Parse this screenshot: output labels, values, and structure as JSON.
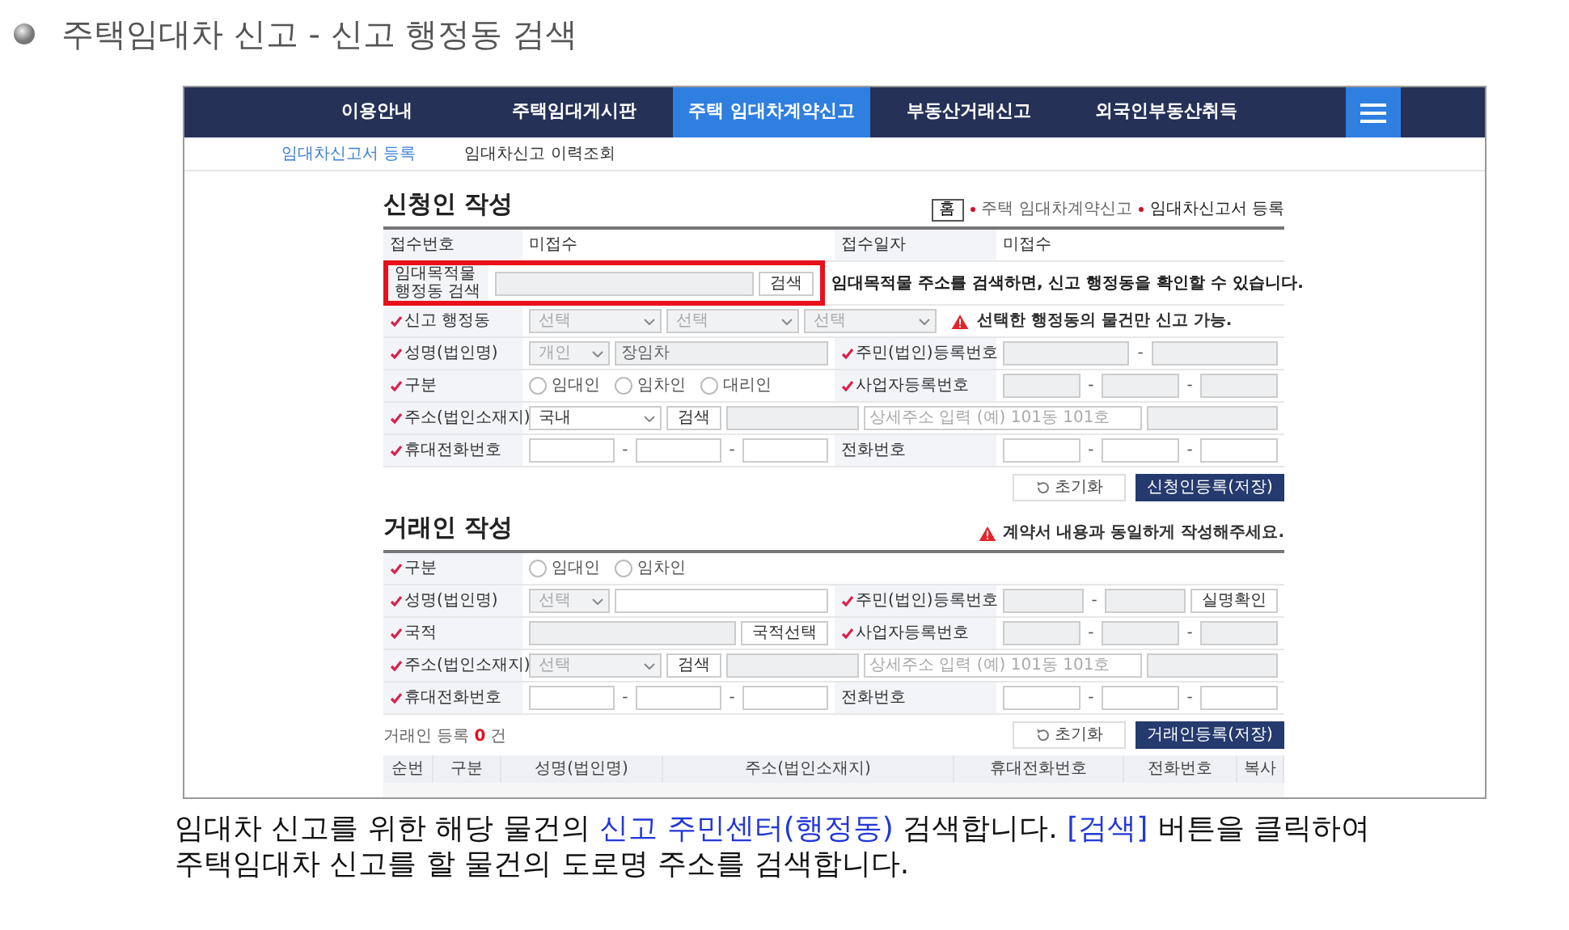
{
  "slide": {
    "title": "주택임대차 신고 - 신고 행정동 검색"
  },
  "nav": {
    "items": [
      {
        "label": "이용안내",
        "selected": false
      },
      {
        "label": "주택임대게시판",
        "selected": false
      },
      {
        "label": "주택 임대차계약신고",
        "selected": true
      },
      {
        "label": "부동산거래신고",
        "selected": false
      },
      {
        "label": "외국인부동산취득",
        "selected": false
      }
    ]
  },
  "subnav": {
    "items": [
      {
        "label": "임대차신고서 등록",
        "selected": true
      },
      {
        "label": "임대차신고 이력조회",
        "selected": false
      }
    ]
  },
  "applicant": {
    "title": "신청인 작성",
    "breadcrumb": {
      "home": "홈",
      "items": [
        {
          "label": "주택 임대차계약신고",
          "selected": false
        },
        {
          "label": "임대차신고서 등록",
          "selected": true
        }
      ]
    },
    "rows": [
      {
        "cells": [
          {
            "label": "접수번호",
            "required": false,
            "controls": [
              {
                "kind": "text",
                "text": "미접수"
              }
            ]
          },
          {
            "label": "접수일자",
            "required": false,
            "controls": [
              {
                "kind": "text",
                "text": "미접수"
              }
            ]
          }
        ]
      },
      {
        "cells": [
          {
            "label": "임대목적물 행정동 검색",
            "required": false,
            "highlighted": true,
            "controls": [
              {
                "kind": "input",
                "disabled": true
              },
              {
                "kind": "button",
                "label": "검색"
              }
            ],
            "note": "임대목적물 주소를 검색하면, 신고 행정동을 확인할 수 있습니다."
          }
        ]
      },
      {
        "cells": [
          {
            "label": "신고 행정동",
            "required": true,
            "controls": [
              {
                "kind": "select",
                "value": "선택",
                "disabled": true
              },
              {
                "kind": "select",
                "value": "선택",
                "disabled": true
              },
              {
                "kind": "select",
                "value": "선택",
                "disabled": true
              },
              {
                "kind": "warning",
                "text": "선택한 행정동의 물건만 신고 가능."
              }
            ]
          }
        ]
      },
      {
        "cells": [
          {
            "label": "성명(법인명)",
            "required": true,
            "controls": [
              {
                "kind": "select",
                "value": "개인",
                "disabled": true
              },
              {
                "kind": "input",
                "value": "장임차",
                "disabled": true
              }
            ]
          },
          {
            "label": "주민(법인)등록번호",
            "required": true,
            "controls": [
              {
                "kind": "input",
                "disabled": true
              },
              {
                "kind": "dash",
                "text": "-"
              },
              {
                "kind": "input",
                "disabled": true
              }
            ]
          }
        ]
      },
      {
        "cells": [
          {
            "label": "구분",
            "required": true,
            "controls": [
              {
                "kind": "radio",
                "label": "임대인",
                "selected": false
              },
              {
                "kind": "radio",
                "label": "임차인",
                "selected": false
              },
              {
                "kind": "radio",
                "label": "대리인",
                "selected": false
              }
            ]
          },
          {
            "label": "사업자등록번호",
            "required": true,
            "controls": [
              {
                "kind": "input",
                "disabled": true
              },
              {
                "kind": "dash",
                "text": "-"
              },
              {
                "kind": "input",
                "disabled": true
              },
              {
                "kind": "dash",
                "text": "-"
              },
              {
                "kind": "input",
                "disabled": true
              }
            ]
          }
        ]
      },
      {
        "cells": [
          {
            "label": "주소(법인소재지)",
            "required": true,
            "controls": [
              {
                "kind": "select",
                "value": "국내",
                "disabled": false
              },
              {
                "kind": "button",
                "label": "검색"
              },
              {
                "kind": "input",
                "disabled": true
              },
              {
                "kind": "input",
                "placeholder": "상세주소 입력 (예) 101동 101호",
                "disabled": false
              },
              {
                "kind": "input",
                "disabled": true
              }
            ]
          }
        ]
      },
      {
        "cells": [
          {
            "label": "휴대전화번호",
            "required": true,
            "controls": [
              {
                "kind": "input",
                "disabled": false
              },
              {
                "kind": "dash",
                "text": "-"
              },
              {
                "kind": "input",
                "disabled": false
              },
              {
                "kind": "dash",
                "text": "-"
              },
              {
                "kind": "input",
                "disabled": false
              }
            ]
          },
          {
            "label": "전화번호",
            "required": false,
            "controls": [
              {
                "kind": "input",
                "disabled": false
              },
              {
                "kind": "dash",
                "text": "-"
              },
              {
                "kind": "input",
                "disabled": false
              },
              {
                "kind": "dash",
                "text": "-"
              },
              {
                "kind": "input",
                "disabled": false
              }
            ]
          }
        ]
      }
    ],
    "buttons": [
      {
        "kind": "reset",
        "label": "초기화"
      },
      {
        "kind": "save",
        "label": "신청인등록(저장)"
      }
    ]
  },
  "counterparty": {
    "title": "거래인 작성",
    "warning": "계약서 내용과 동일하게 작성해주세요.",
    "rows": [
      {
        "cells": [
          {
            "label": "구분",
            "required": true,
            "controls": [
              {
                "kind": "radio",
                "label": "임대인",
                "selected": false
              },
              {
                "kind": "radio",
                "label": "임차인",
                "selected": false
              }
            ]
          }
        ]
      },
      {
        "cells": [
          {
            "label": "성명(법인명)",
            "required": true,
            "controls": [
              {
                "kind": "select",
                "value": "선택",
                "disabled": true
              },
              {
                "kind": "input",
                "disabled": false
              }
            ]
          },
          {
            "label": "주민(법인)등록번호",
            "required": true,
            "controls": [
              {
                "kind": "input",
                "disabled": true
              },
              {
                "kind": "dash",
                "text": "-"
              },
              {
                "kind": "input",
                "disabled": true
              },
              {
                "kind": "button",
                "label": "실명확인"
              }
            ]
          }
        ]
      },
      {
        "cells": [
          {
            "label": "국적",
            "required": true,
            "controls": [
              {
                "kind": "input",
                "disabled": true
              },
              {
                "kind": "button",
                "label": "국적선택"
              }
            ]
          },
          {
            "label": "사업자등록번호",
            "required": true,
            "controls": [
              {
                "kind": "input",
                "disabled": true
              },
              {
                "kind": "dash",
                "text": "-"
              },
              {
                "kind": "input",
                "disabled": true
              },
              {
                "kind": "dash",
                "text": "-"
              },
              {
                "kind": "input",
                "disabled": true
              }
            ]
          }
        ]
      },
      {
        "cells": [
          {
            "label": "주소(법인소재지)",
            "required": true,
            "controls": [
              {
                "kind": "select",
                "value": "선택",
                "disabled": true
              },
              {
                "kind": "button",
                "label": "검색"
              },
              {
                "kind": "input",
                "disabled": true
              },
              {
                "kind": "input",
                "placeholder": "상세주소 입력 (예) 101동 101호",
                "disabled": false
              },
              {
                "kind": "input",
                "disabled": true
              }
            ]
          }
        ]
      },
      {
        "cells": [
          {
            "label": "휴대전화번호",
            "required": true,
            "controls": [
              {
                "kind": "input",
                "disabled": false
              },
              {
                "kind": "dash",
                "text": "-"
              },
              {
                "kind": "input",
                "disabled": false
              },
              {
                "kind": "dash",
                "text": "-"
              },
              {
                "kind": "input",
                "disabled": false
              }
            ]
          },
          {
            "label": "전화번호",
            "required": false,
            "controls": [
              {
                "kind": "input",
                "disabled": false
              },
              {
                "kind": "dash",
                "text": "-"
              },
              {
                "kind": "input",
                "disabled": false
              },
              {
                "kind": "dash",
                "text": "-"
              },
              {
                "kind": "input",
                "disabled": false
              }
            ]
          }
        ]
      }
    ],
    "count": {
      "prefix": "거래인 등록",
      "value": "0",
      "suffix": "건"
    },
    "buttons": [
      {
        "kind": "reset",
        "label": "초기화"
      },
      {
        "kind": "save",
        "label": "거래인등록(저장)"
      }
    ],
    "table": {
      "columns": [
        "순번",
        "구분",
        "성명(법인명)",
        "주소(법인소재지)",
        "휴대전화번호",
        "전화번호",
        "복사"
      ]
    }
  },
  "caption": {
    "segments": [
      {
        "text": "임대차 신고를 위한 해당 물건의 ",
        "emphasis": false
      },
      {
        "text": "신고 주민센터(행정동)",
        "emphasis": true
      },
      {
        "text": " 검색합니다. ",
        "emphasis": false
      },
      {
        "text": "[검색]",
        "emphasis": true
      },
      {
        "text": " 버튼을 클릭하여 주택임대차 신고를 할 물건의 도로명 주소를 검색합니다.",
        "emphasis": false
      }
    ]
  }
}
